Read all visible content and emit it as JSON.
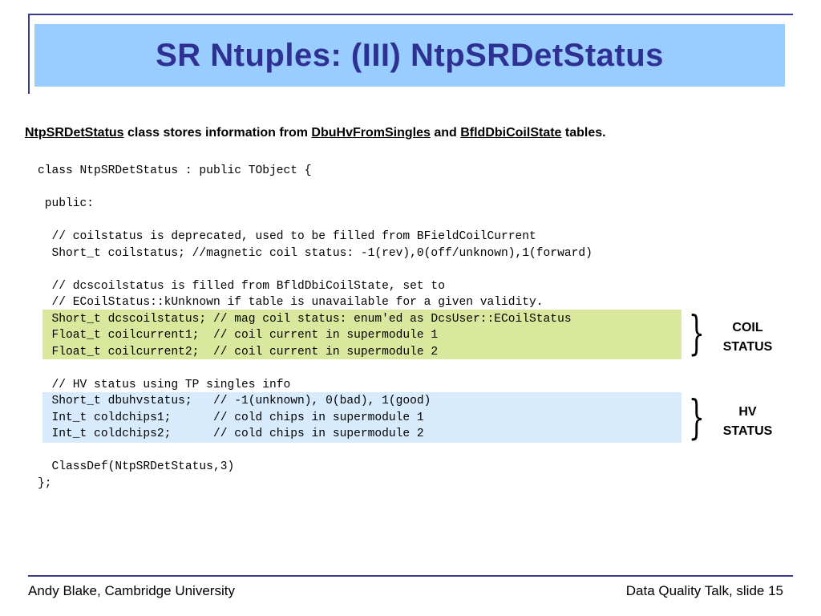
{
  "slide": {
    "title": "SR Ntuples: (III) NtpSRDetStatus"
  },
  "intro": {
    "class_name": "NtpSRDetStatus",
    "text1": " class stores information from ",
    "table1": "DbuHvFromSingles",
    "text2": " and ",
    "table2": "BfldDbiCoilState",
    "text3": " tables."
  },
  "code_lines": [
    "class NtpSRDetStatus : public TObject {",
    "",
    " public:",
    "",
    "  // coilstatus is deprecated, used to be filled from BFieldCoilCurrent",
    "  Short_t coilstatus; //magnetic coil status: -1(rev),0(off/unknown),1(forward)",
    "",
    "  // dcscoilstatus is filled from BfldDbiCoilState, set to",
    "  // ECoilStatus::kUnknown if table is unavailable for a given validity.",
    "  Short_t dcscoilstatus; // mag coil status: enum'ed as DcsUser::ECoilStatus",
    "  Float_t coilcurrent1;  // coil current in supermodule 1",
    "  Float_t coilcurrent2;  // coil current in supermodule 2",
    "",
    "  // HV status using TP singles info",
    "  Short_t dbuhvstatus;   // -1(unknown), 0(bad), 1(good)",
    "  Int_t coldchips1;      // cold chips in supermodule 1",
    "  Int_t coldchips2;      // cold chips in supermodule 2",
    "",
    "  ClassDef(NtpSRDetStatus,3)",
    "};"
  ],
  "annotations": {
    "coil_line1": "COIL",
    "coil_line2": "STATUS",
    "hv_line1": "HV",
    "hv_line2": "STATUS",
    "brace_glyph": "}"
  },
  "footer": {
    "author": "Andy Blake, Cambridge University",
    "slide_ref": "Data Quality Talk, slide 15"
  },
  "colors": {
    "title_band": "#99ccff",
    "title_text": "#2e3192",
    "coil_highlight": "#d9e89c",
    "hv_highlight": "#d8ebfc",
    "rule": "#3a3d8f"
  }
}
